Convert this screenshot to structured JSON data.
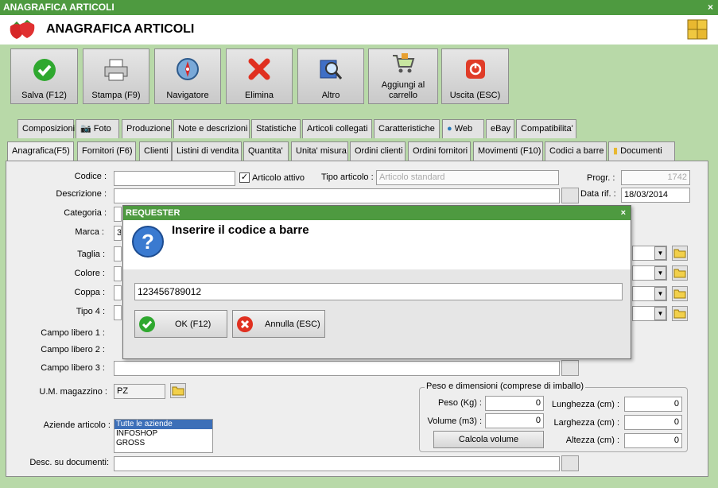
{
  "window": {
    "title": "ANAGRAFICA ARTICOLI",
    "close": "×"
  },
  "header": {
    "title": "ANAGRAFICA ARTICOLI"
  },
  "toolbar": [
    {
      "label": "Salva (F12)",
      "icon": "check-icon"
    },
    {
      "label": "Stampa (F9)",
      "icon": "printer-icon"
    },
    {
      "label": "Navigatore",
      "icon": "compass-icon"
    },
    {
      "label": "Elimina",
      "icon": "delete-icon"
    },
    {
      "label": "Altro",
      "icon": "book-search-icon"
    },
    {
      "label": "Aggiungi al carrello",
      "icon": "cart-icon"
    },
    {
      "label": "Uscita (ESC)",
      "icon": "exit-icon"
    }
  ],
  "tabs_row1": [
    "Composizioni",
    "Foto",
    "Produzione",
    "Note e descrizioni",
    "Statistiche",
    "Articoli collegati",
    "Caratteristiche",
    "Web",
    "eBay",
    "Compatibilita'"
  ],
  "tabs_row2": [
    "Anagrafica(F5)",
    "Fornitori (F6)",
    "Clienti",
    "Listini di vendita",
    "Quantita'",
    "Unita' misura",
    "Ordini clienti",
    "Ordini fornitori",
    "Movimenti (F10)",
    "Codici a barre",
    "Documenti"
  ],
  "form": {
    "codice_label": "Codice :",
    "codice_value": "",
    "articolo_attivo_label": "Articolo attivo",
    "articolo_attivo_checked": true,
    "tipo_articolo_label": "Tipo articolo :",
    "tipo_articolo_placeholder": "Articolo standard",
    "progr_label": "Progr. :",
    "progr_value": "1742",
    "descrizione_label": "Descrizione :",
    "data_rif_label": "Data rif. :",
    "data_rif_value": "18/03/2014",
    "categoria_label": "Categoria :",
    "marca_label": "Marca :",
    "marca_value": "3(",
    "taglia_label": "Taglia :",
    "colore_label": "Colore :",
    "coppa_label": "Coppa :",
    "tipo4_label": "Tipo 4 :",
    "campo1_label": "Campo libero 1 :",
    "campo2_label": "Campo libero 2 :",
    "campo3_label": "Campo libero 3 :",
    "um_label": "U.M. magazzino :",
    "um_value": "PZ",
    "aziende_label": "Aziende articolo :",
    "aziende": [
      "Tutte le aziende",
      "INFOSHOP",
      "GROSS"
    ],
    "desc_doc_label": "Desc. su documenti:"
  },
  "peso": {
    "group_label": "Peso e dimensioni (comprese di imballo)",
    "peso_label": "Peso (Kg) :",
    "peso_value": "0",
    "volume_label": "Volume (m3) :",
    "volume_value": "0",
    "calcola_label": "Calcola volume",
    "lunghezza_label": "Lunghezza (cm) :",
    "lunghezza_value": "0",
    "larghezza_label": "Larghezza (cm) :",
    "larghezza_value": "0",
    "altezza_label": "Altezza (cm) :",
    "altezza_value": "0"
  },
  "dialog": {
    "title": "REQUESTER",
    "close": "×",
    "message": "Inserire il codice a barre",
    "input_value": "123456789012",
    "ok_label": "OK (F12)",
    "cancel_label": "Annulla (ESC)"
  },
  "colors": {
    "title_bar": "#4e9a40",
    "background": "#b8d9a8",
    "panel": "#eeeeee",
    "selected": "#3c6fb8"
  }
}
